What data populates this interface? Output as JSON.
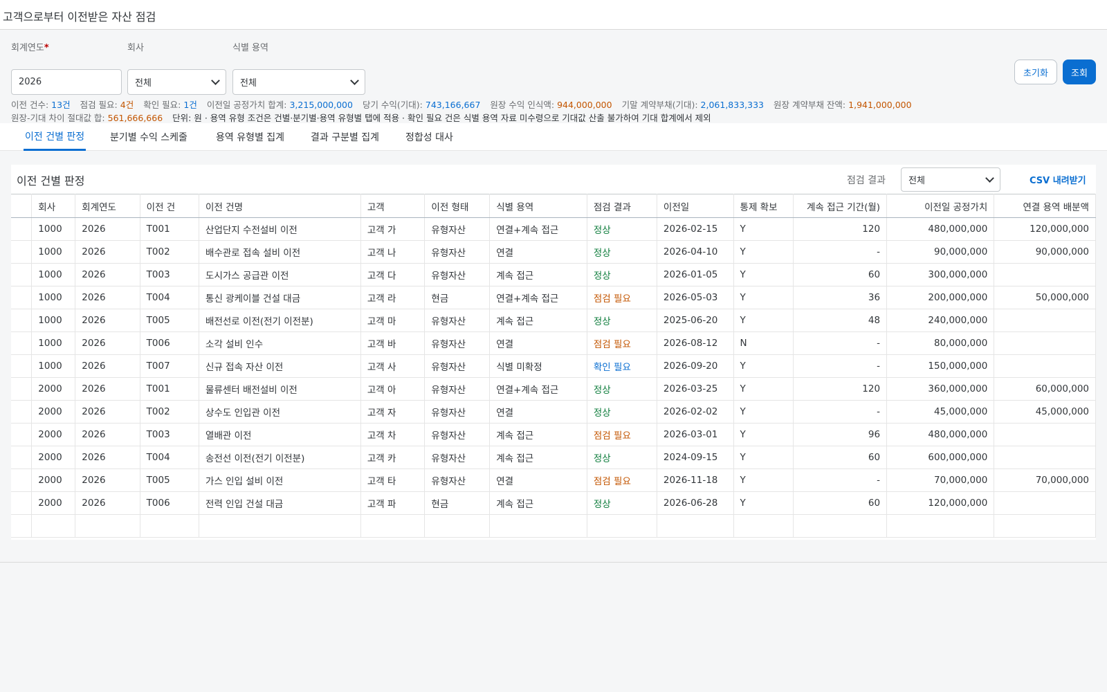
{
  "page": {
    "title": "고객으로부터 이전받은 자산 점검"
  },
  "filters": {
    "fiscal_year": {
      "label": "회계연도",
      "required_mark": "*",
      "value": "2026"
    },
    "company": {
      "label": "회사",
      "value": "전체"
    },
    "identified_service": {
      "label": "식별 용역",
      "value": "전체"
    },
    "reset_label": "초기화",
    "search_label": "조회"
  },
  "summary": {
    "items": [
      {
        "label": "이전 건수:",
        "value": "13건",
        "color": "blue"
      },
      {
        "label": "점검 필요:",
        "value": "4건",
        "color": "orange"
      },
      {
        "label": "확인 필요:",
        "value": "1건",
        "color": "blue"
      },
      {
        "label": "이전일 공정가치 합계:",
        "value": "3,215,000,000",
        "color": "blue"
      },
      {
        "label": "당기 수익(기대):",
        "value": "743,166,667",
        "color": "blue"
      },
      {
        "label": "원장 수익 인식액:",
        "value": "944,000,000",
        "color": "orange"
      },
      {
        "label": "기말 계약부채(기대):",
        "value": "2,061,833,333",
        "color": "blue"
      },
      {
        "label": "원장 계약부채 잔액:",
        "value": "1,941,000,000",
        "color": "orange"
      }
    ],
    "diff_label": "원장-기대 차이 절대값 합:",
    "diff_value": "561,666,666",
    "note": "단위: 원 · 용역 유형 조건은 건별·분기별·용역 유형별 탭에 적용 · 확인 필요 건은 식별 용역 자료 미수령으로 기대값 산출 불가하여 기대 합계에서 제외"
  },
  "tabs": [
    {
      "label": "이전 건별 판정",
      "active": true
    },
    {
      "label": "분기별 수익 스케줄",
      "active": false
    },
    {
      "label": "용역 유형별 집계",
      "active": false
    },
    {
      "label": "결과 구분별 집계",
      "active": false
    },
    {
      "label": "정합성 대사",
      "active": false
    }
  ],
  "panel": {
    "title": "이전 건별 판정",
    "result_filter_label": "점검 결과",
    "result_filter_value": "전체",
    "csv_label": "CSV 내려받기"
  },
  "table": {
    "columns": [
      "",
      "회사",
      "회계연도",
      "이전 건",
      "이전 건명",
      "고객",
      "이전 형태",
      "식별 용역",
      "점검 결과",
      "이전일",
      "통제 확보",
      "계속 접근 기간(월)",
      "이전일 공정가치",
      "연결 용역 배분액"
    ],
    "rows": [
      [
        "1000",
        "2026",
        "T001",
        "산업단지 수전설비 이전",
        "고객 가",
        "유형자산",
        "연결+계속 접근",
        "정상",
        "2026-02-15",
        "Y",
        "120",
        "480,000,000",
        "120,000,000"
      ],
      [
        "1000",
        "2026",
        "T002",
        "배수관로 접속 설비 이전",
        "고객 나",
        "유형자산",
        "연결",
        "정상",
        "2026-04-10",
        "Y",
        "-",
        "90,000,000",
        "90,000,000"
      ],
      [
        "1000",
        "2026",
        "T003",
        "도시가스 공급관 이전",
        "고객 다",
        "유형자산",
        "계속 접근",
        "정상",
        "2026-01-05",
        "Y",
        "60",
        "300,000,000",
        ""
      ],
      [
        "1000",
        "2026",
        "T004",
        "통신 광케이블 건설 대금",
        "고객 라",
        "현금",
        "연결+계속 접근",
        "점검 필요",
        "2026-05-03",
        "Y",
        "36",
        "200,000,000",
        "50,000,000"
      ],
      [
        "1000",
        "2026",
        "T005",
        "배전선로 이전(전기 이전분)",
        "고객 마",
        "유형자산",
        "계속 접근",
        "정상",
        "2025-06-20",
        "Y",
        "48",
        "240,000,000",
        ""
      ],
      [
        "1000",
        "2026",
        "T006",
        "소각 설비 인수",
        "고객 바",
        "유형자산",
        "연결",
        "점검 필요",
        "2026-08-12",
        "N",
        "-",
        "80,000,000",
        ""
      ],
      [
        "1000",
        "2026",
        "T007",
        "신규 접속 자산 이전",
        "고객 사",
        "유형자산",
        "식별 미확정",
        "확인 필요",
        "2026-09-20",
        "Y",
        "-",
        "150,000,000",
        ""
      ],
      [
        "2000",
        "2026",
        "T001",
        "물류센터 배전설비 이전",
        "고객 아",
        "유형자산",
        "연결+계속 접근",
        "정상",
        "2026-03-25",
        "Y",
        "120",
        "360,000,000",
        "60,000,000"
      ],
      [
        "2000",
        "2026",
        "T002",
        "상수도 인입관 이전",
        "고객 자",
        "유형자산",
        "연결",
        "정상",
        "2026-02-02",
        "Y",
        "-",
        "45,000,000",
        "45,000,000"
      ],
      [
        "2000",
        "2026",
        "T003",
        "열배관 이전",
        "고객 차",
        "유형자산",
        "계속 접근",
        "점검 필요",
        "2026-03-01",
        "Y",
        "96",
        "480,000,000",
        ""
      ],
      [
        "2000",
        "2026",
        "T004",
        "송전선 이전(전기 이전분)",
        "고객 카",
        "유형자산",
        "계속 접근",
        "정상",
        "2024-09-15",
        "Y",
        "60",
        "600,000,000",
        ""
      ],
      [
        "2000",
        "2026",
        "T005",
        "가스 인입 설비 이전",
        "고객 타",
        "유형자산",
        "연결",
        "점검 필요",
        "2026-11-18",
        "Y",
        "-",
        "70,000,000",
        "70,000,000"
      ],
      [
        "2000",
        "2026",
        "T006",
        "전력 인입 건설 대금",
        "고객 파",
        "현금",
        "계속 접근",
        "정상",
        "2026-06-28",
        "Y",
        "60",
        "120,000,000",
        ""
      ]
    ]
  },
  "colors": {
    "accent": "#0a6ed1",
    "ok": "#107e3e",
    "warning": "#c35500",
    "check": "#0a6ed1"
  }
}
